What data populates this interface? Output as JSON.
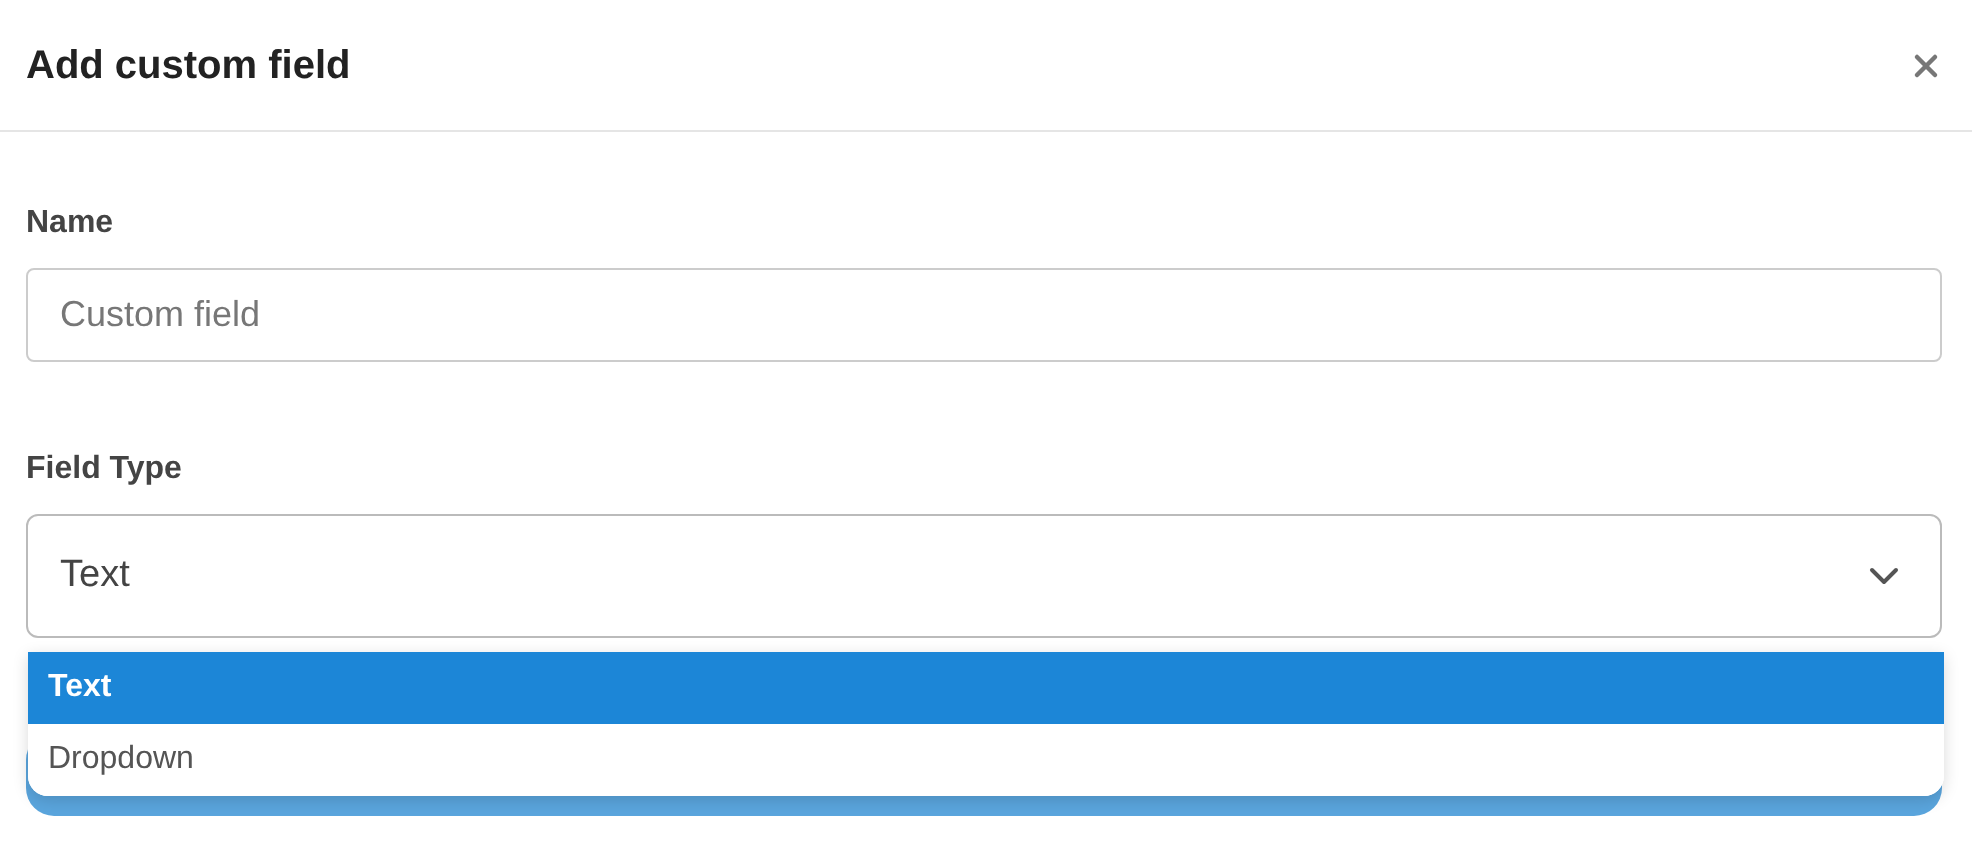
{
  "dialog": {
    "title": "Add custom field"
  },
  "name_field": {
    "label": "Name",
    "placeholder": "Custom field"
  },
  "field_type": {
    "label": "Field Type",
    "value": "Text",
    "expanded": true,
    "options": [
      {
        "label": "Text",
        "selected": true
      },
      {
        "label": "Dropdown",
        "selected": false
      }
    ]
  }
}
